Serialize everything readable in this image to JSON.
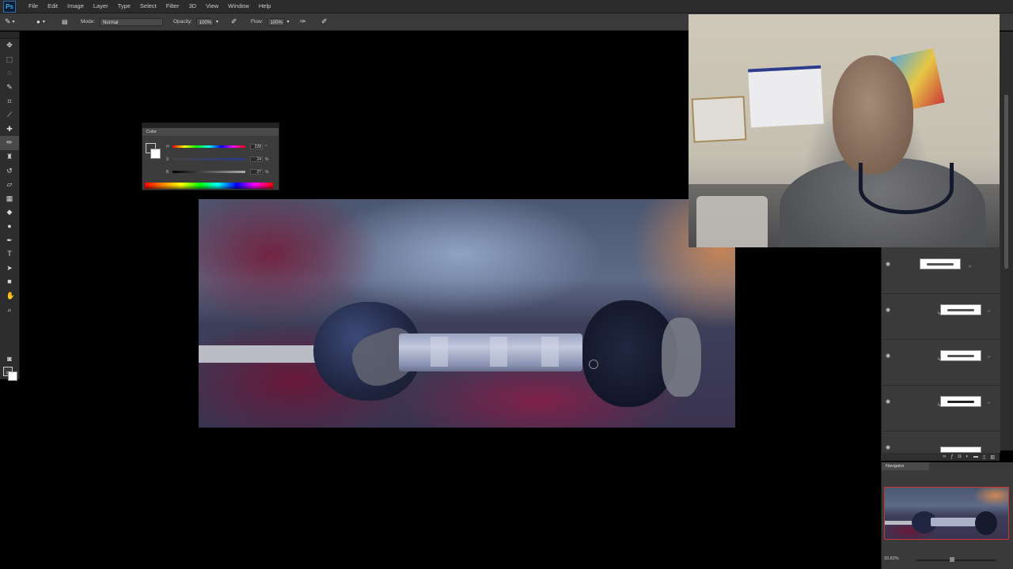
{
  "app": {
    "logo": "Ps",
    "menu": [
      "File",
      "Edit",
      "Image",
      "Layer",
      "Type",
      "Select",
      "Filter",
      "3D",
      "View",
      "Window",
      "Help"
    ]
  },
  "options": {
    "mode_label": "Mode:",
    "mode_value": "Normal",
    "opacity_label": "Opacity:",
    "opacity_value": "100%",
    "flow_label": "Flow:",
    "flow_value": "100%"
  },
  "tools": [
    "move-tool",
    "marquee-tool",
    "lasso-tool",
    "quick-select-tool",
    "crop-tool",
    "eyedropper-tool",
    "healing-tool",
    "brush-tool",
    "clone-stamp-tool",
    "history-brush-tool",
    "eraser-tool",
    "gradient-tool",
    "blur-tool",
    "dodge-tool",
    "pen-tool",
    "type-tool",
    "path-select-tool",
    "shape-tool",
    "hand-tool",
    "zoom-tool"
  ],
  "color_panel": {
    "tab": "Color",
    "rows": [
      {
        "label": "H",
        "value": "228",
        "unit": "°"
      },
      {
        "label": "S",
        "value": "24",
        "unit": "%"
      },
      {
        "label": "B",
        "value": "27",
        "unit": "%"
      }
    ]
  },
  "navigator": {
    "tab": "Navigator",
    "zoom": "33.82%"
  },
  "colors": {
    "accent": "#2f6fb0",
    "panel": "#3a3a3a",
    "menubar": "#2b2b2b"
  }
}
